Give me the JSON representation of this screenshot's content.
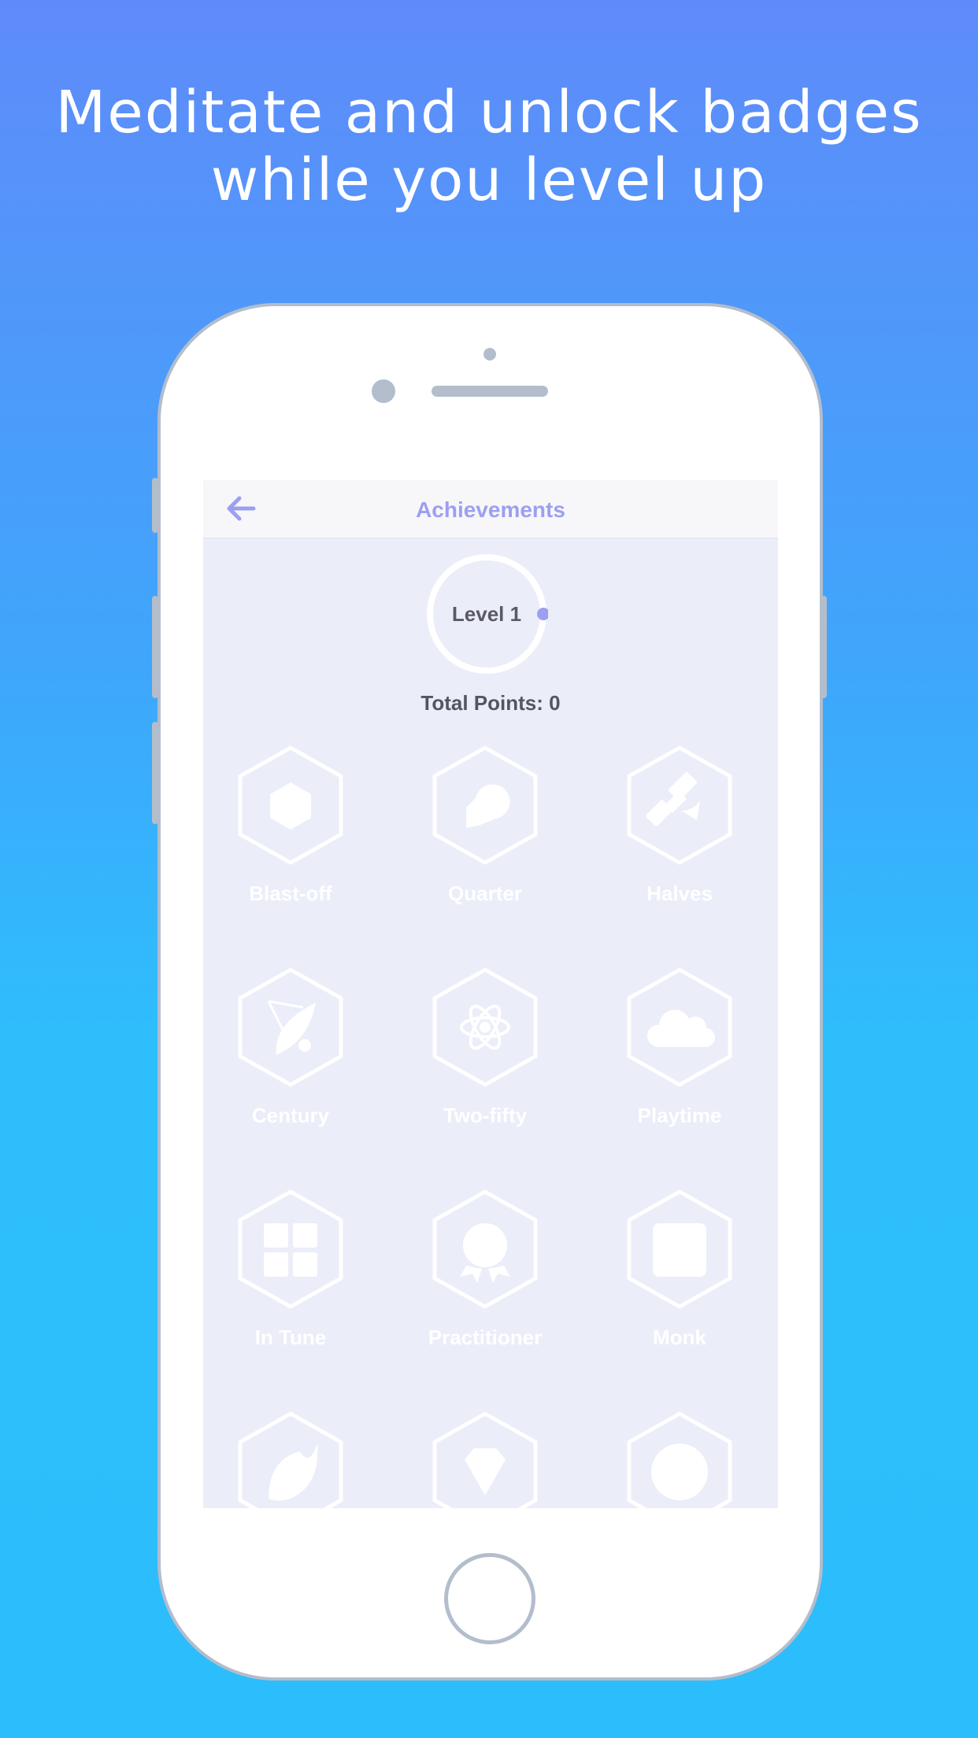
{
  "headline": {
    "line1": "Meditate and unlock badges",
    "line2": "while you level up"
  },
  "screen": {
    "title": "Achievements",
    "back_icon": "arrow-left-icon",
    "level_label": "Level 1",
    "level_progress": 0,
    "total_points": "Total Points: 0",
    "badges": [
      {
        "label": "Blast-off",
        "icon": "hexagon-icon"
      },
      {
        "label": "Quarter",
        "icon": "bubble-icon"
      },
      {
        "label": "Halves",
        "icon": "satellite-icon"
      },
      {
        "label": "Century",
        "icon": "satellite-dish-icon"
      },
      {
        "label": "Two-fifty",
        "icon": "atom-icon"
      },
      {
        "label": "Playtime",
        "icon": "cloud-icon"
      },
      {
        "label": "In Tune",
        "icon": "grid-icon"
      },
      {
        "label": "Practitioner",
        "icon": "award-ribbon-icon"
      },
      {
        "label": "Monk",
        "icon": "square-icon"
      },
      {
        "label": "",
        "icon": "leaf-icon"
      },
      {
        "label": "",
        "icon": "diamond-icon"
      },
      {
        "label": "",
        "icon": "circle-icon"
      }
    ]
  },
  "colors": {
    "accent": "#9c9ff0",
    "screen_bg": "#ebedf9",
    "badge": "#ffffff",
    "phone_frame": "#b3bdcc"
  }
}
